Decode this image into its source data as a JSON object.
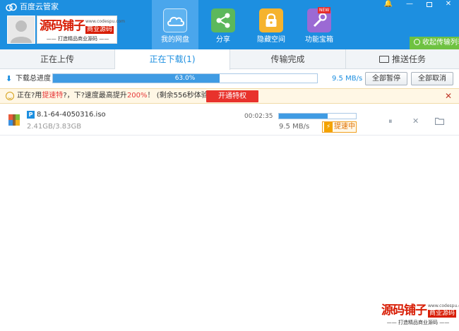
{
  "app": {
    "title": "百度云管家"
  },
  "window_controls": {
    "bell": "🔔",
    "minimize": "—",
    "close": "✕"
  },
  "banner": {
    "big_text": "源码铺子",
    "tag": "商业源码",
    "url": "www.codespu.com",
    "slogan": "—— 打造精品商业源码 ——"
  },
  "nav": [
    {
      "label": "我的网盘",
      "icon": "cloud-icon"
    },
    {
      "label": "分享",
      "icon": "share-icon"
    },
    {
      "label": "隐藏空间",
      "icon": "lock-icon"
    },
    {
      "label": "功能宝箱",
      "icon": "toolbox-icon",
      "badge": "NEW"
    }
  ],
  "collapse_label": "收起传输列表",
  "tabs": [
    {
      "label": "正在上传"
    },
    {
      "label": "正在下载(1)"
    },
    {
      "label": "传输完成"
    },
    {
      "label": "推送任务"
    }
  ],
  "progress": {
    "label": "下载总进度",
    "percent": 63.0,
    "percent_text": "63.0%",
    "speed": "9.5 MB/s",
    "pause_all": "全部暂停",
    "cancel_all": "全部取消"
  },
  "promo": {
    "t1": "正在?用",
    "h1": "提速特",
    "t2": "?，下?速度最高提升",
    "h2": "200%",
    "t3": "！ (剩余556秒体验结束)",
    "button": "开通特权",
    "close": "✕"
  },
  "downloads": [
    {
      "badge": "P",
      "name": "8.1-64-4050316.iso",
      "size": "2.41GB/3.83GB",
      "remaining": "00:02:35",
      "progress": 0.63,
      "speed": "9.5 MB/s",
      "accel": "提速中",
      "accel_icon": "⚡",
      "pause": "⏸",
      "cancel": "✕"
    }
  ],
  "watermark": {
    "big_text": "源码铺子",
    "tag": "商业源码",
    "url": "www.codespu.com",
    "slogan": "—— 打造精品商业源码 ——"
  },
  "colors": {
    "accent": "#1d8fe0",
    "nav_active": "#4aa6ec",
    "green": "#6ec241",
    "red": "#e8322c",
    "progress": "#3f9be3"
  }
}
